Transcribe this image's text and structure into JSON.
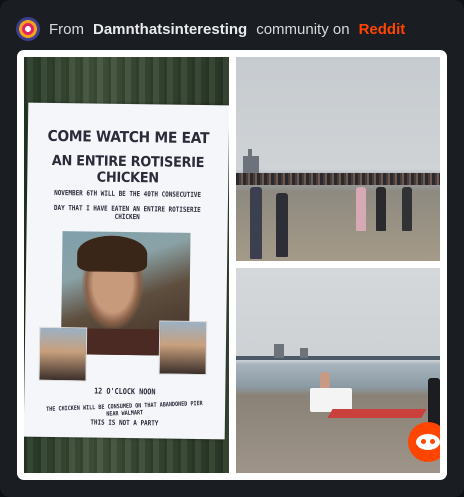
{
  "header": {
    "prefix": "From",
    "community": "Damnthatsinteresting",
    "middle": "community on",
    "site": "Reddit",
    "site_color": "#ff4500"
  },
  "poster": {
    "line1": "COME WATCH ME EAT",
    "line2": "AN ENTIRE ROTISERIE CHICKEN",
    "detail1": "NOVEMBER 6TH WILL BE THE 40TH CONSECUTIVE",
    "detail2": "DAY THAT I HAVE EATEN AN ENTIRE ROTISERIE CHICKEN",
    "time": "12 O'CLOCK NOON",
    "location": "THE CHICKEN WILL BE CONSUMED ON THAT ABANDONED PIER NEAR WALMART",
    "footer": "THIS IS NOT A PARTY"
  },
  "icons": {
    "community": "community-avatar-icon",
    "watermark": "reddit-snoo-icon"
  }
}
